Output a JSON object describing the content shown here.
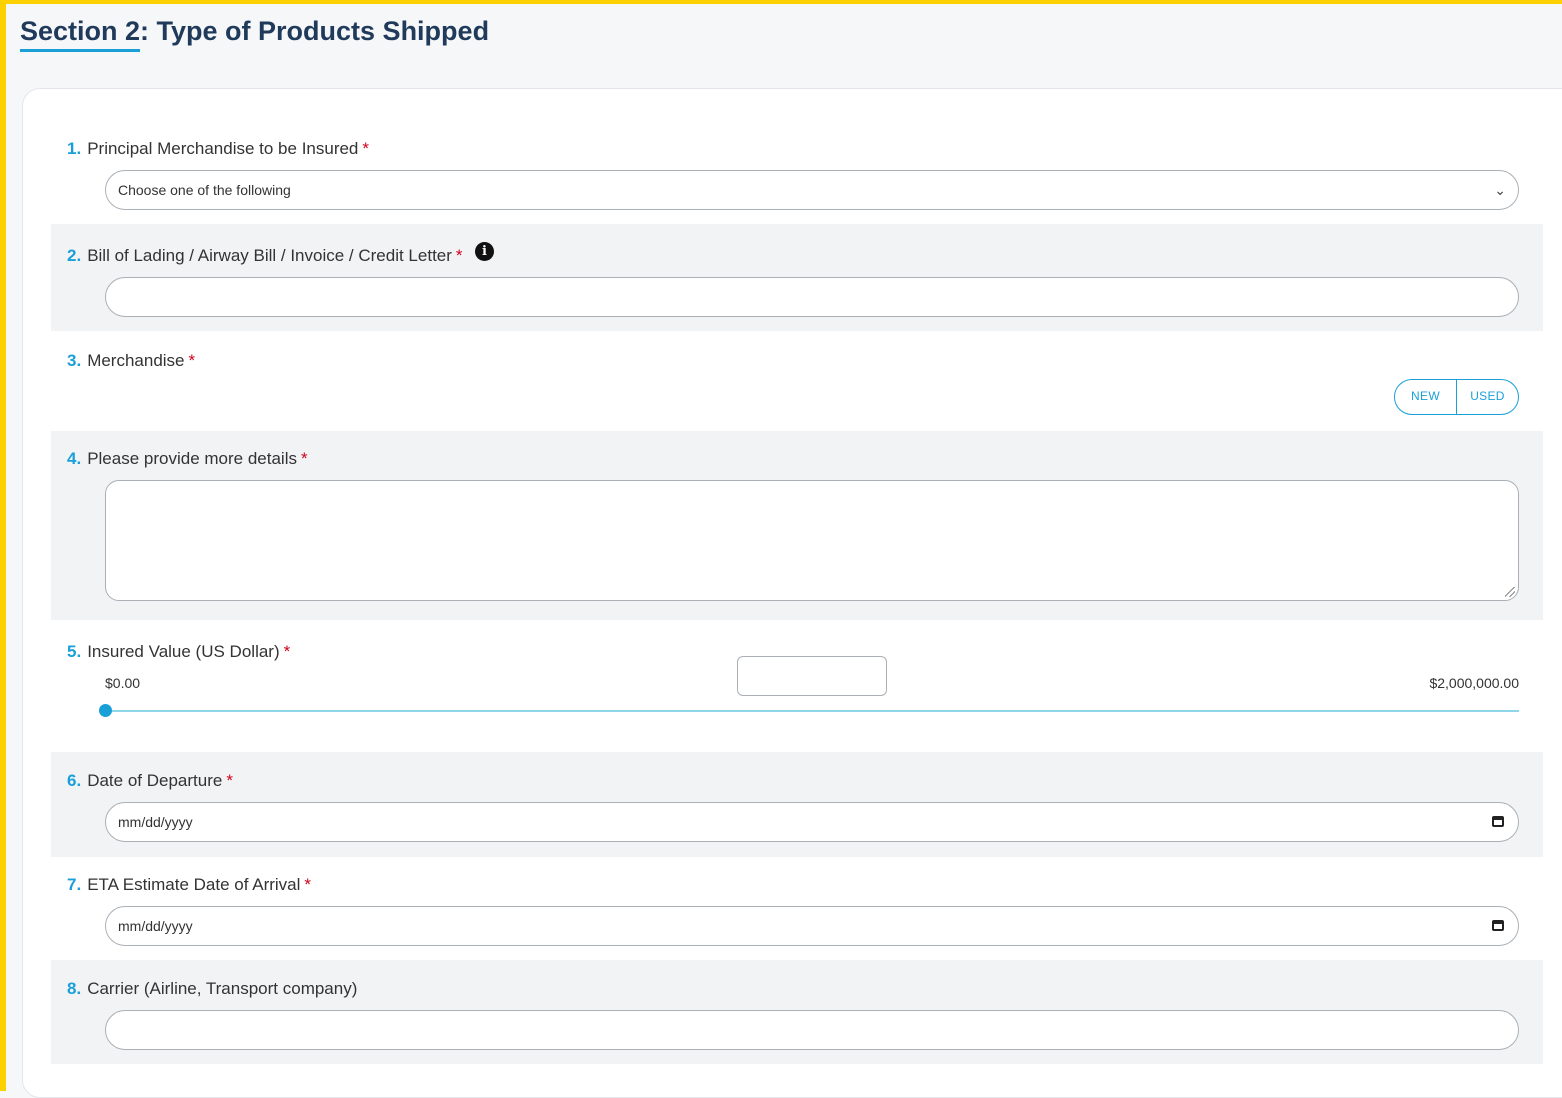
{
  "section": {
    "prefix": "Section 2",
    "rest": ": Type of Products Shipped"
  },
  "q1": {
    "num": "1.",
    "label": "Principal Merchandise to be Insured",
    "required": "*",
    "select_value": "Choose one of the following"
  },
  "q2": {
    "num": "2.",
    "label": "Bill of Lading / Airway Bill / Invoice / Credit Letter",
    "required": "*",
    "info": "i",
    "value": ""
  },
  "q3": {
    "num": "3.",
    "label": "Merchandise",
    "required": "*",
    "options": [
      "NEW",
      "USED"
    ]
  },
  "q4": {
    "num": "4.",
    "label": "Please provide more details",
    "required": "*",
    "value": ""
  },
  "q5": {
    "num": "5.",
    "label": "Insured Value (US Dollar)",
    "required": "*",
    "min_label": "$0.00",
    "max_label": "$2,000,000.00",
    "slider_value_fraction": 0.0,
    "value": ""
  },
  "q6": {
    "num": "6.",
    "label": "Date of Departure",
    "required": "*",
    "placeholder": "mm/dd/yyyy"
  },
  "q7": {
    "num": "7.",
    "label": "ETA Estimate Date of Arrival",
    "required": "*",
    "placeholder": "mm/dd/yyyy"
  },
  "q8": {
    "num": "8.",
    "label": "Carrier (Airline, Transport company)",
    "value": ""
  },
  "colors": {
    "accent": "#1aa0d8",
    "frame": "#fdd000",
    "required": "#d0021b",
    "title": "#1f3a5a"
  },
  "icons": {
    "select": "chevron-down-icon",
    "date": "calendar-icon",
    "info": "info-icon"
  }
}
